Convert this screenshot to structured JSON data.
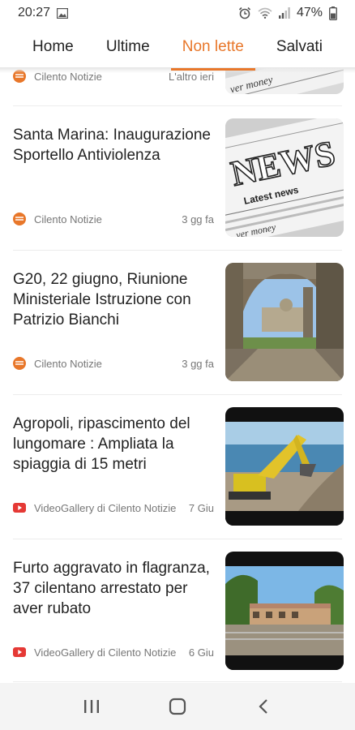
{
  "status_bar": {
    "time": "20:27",
    "battery": "47%",
    "icons": [
      "image-icon",
      "alarm-icon",
      "wifi-icon",
      "signal-icon",
      "battery-icon"
    ]
  },
  "tabs": [
    {
      "label": "Home",
      "active": false
    },
    {
      "label": "Ultime",
      "active": false
    },
    {
      "label": "Non lette",
      "active": true
    },
    {
      "label": "Salvati",
      "active": false
    }
  ],
  "accent_color": "#e8772a",
  "feed": {
    "partial": {
      "source": "Cilento Notizie",
      "date": "L'altro ieri"
    },
    "articles": [
      {
        "title": "Santa Marina: Inaugurazione Sportello Antiviolenza",
        "source": "Cilento Notizie",
        "source_icon": "site-logo-icon",
        "date": "3 gg fa",
        "thumb": "newspaper"
      },
      {
        "title": "G20, 22 giugno, Riunione Ministeriale Istruzione con Patrizio Bianchi",
        "source": "Cilento Notizie",
        "source_icon": "site-logo-icon",
        "date": "3 gg fa",
        "thumb": "cloister"
      },
      {
        "title": "Agropoli, ripascimento del lungomare : Ampliata la spiaggia di 15 metri",
        "source": "VideoGallery di Cilento Notizie",
        "source_icon": "youtube-icon",
        "date": "7 Giu",
        "thumb": "excavator"
      },
      {
        "title": "Furto aggravato in flagranza, 37 cilentano arrestato per aver rubato",
        "source": "VideoGallery di Cilento Notizie",
        "source_icon": "youtube-icon",
        "date": "6 Giu",
        "thumb": "building"
      }
    ]
  },
  "nav_bar": {
    "buttons": [
      "recent-apps-icon",
      "home-icon",
      "back-icon"
    ]
  }
}
